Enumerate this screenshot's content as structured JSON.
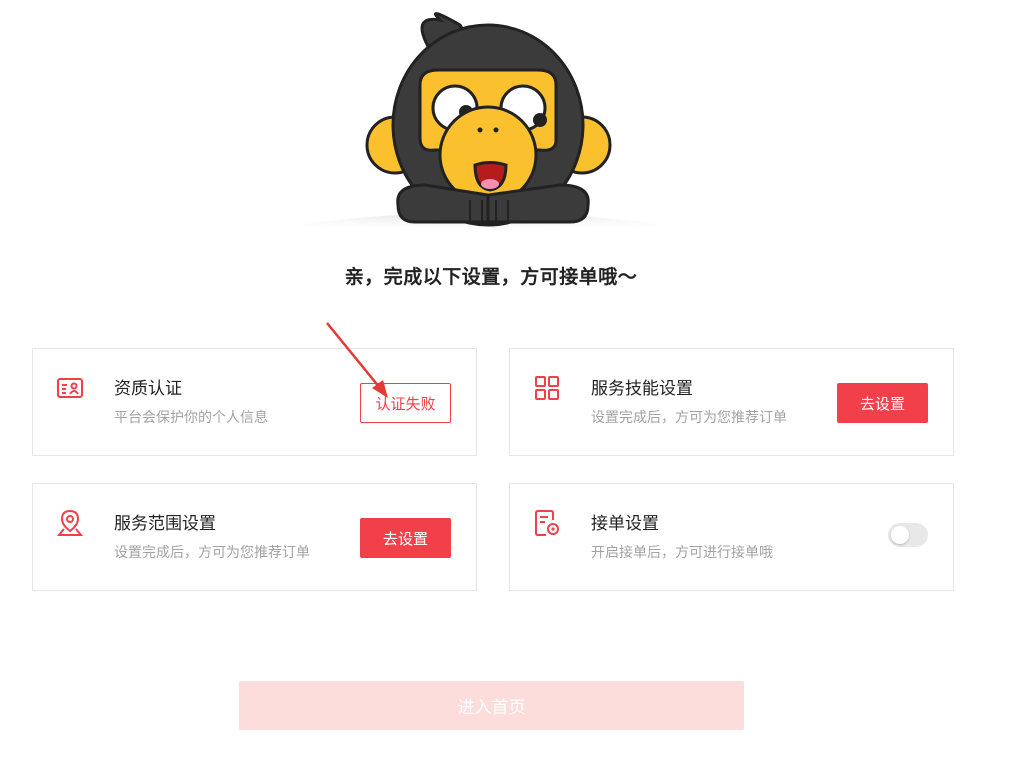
{
  "headline": "亲，完成以下设置，方可接单哦～",
  "cards": {
    "qualification": {
      "title": "资质认证",
      "desc": "平台会保护你的个人信息",
      "action": "认证失败",
      "icon": "id-card-icon"
    },
    "skills": {
      "title": "服务技能设置",
      "desc": "设置完成后，方可为您推荐订单",
      "action": "去设置",
      "icon": "grid-icon"
    },
    "area": {
      "title": "服务范围设置",
      "desc": "设置完成后，方可为您推荐订单",
      "action": "去设置",
      "icon": "location-pin-icon"
    },
    "order": {
      "title": "接单设置",
      "desc": "开启接单后，方可进行接单哦",
      "toggle_on": false,
      "icon": "settings-document-icon"
    }
  },
  "enter_button": "进入首页",
  "colors": {
    "accent": "#f2404a",
    "disabled_button": "#fddcdc",
    "mascot_fur": "#3b3b3b",
    "mascot_face": "#fbc02d"
  }
}
